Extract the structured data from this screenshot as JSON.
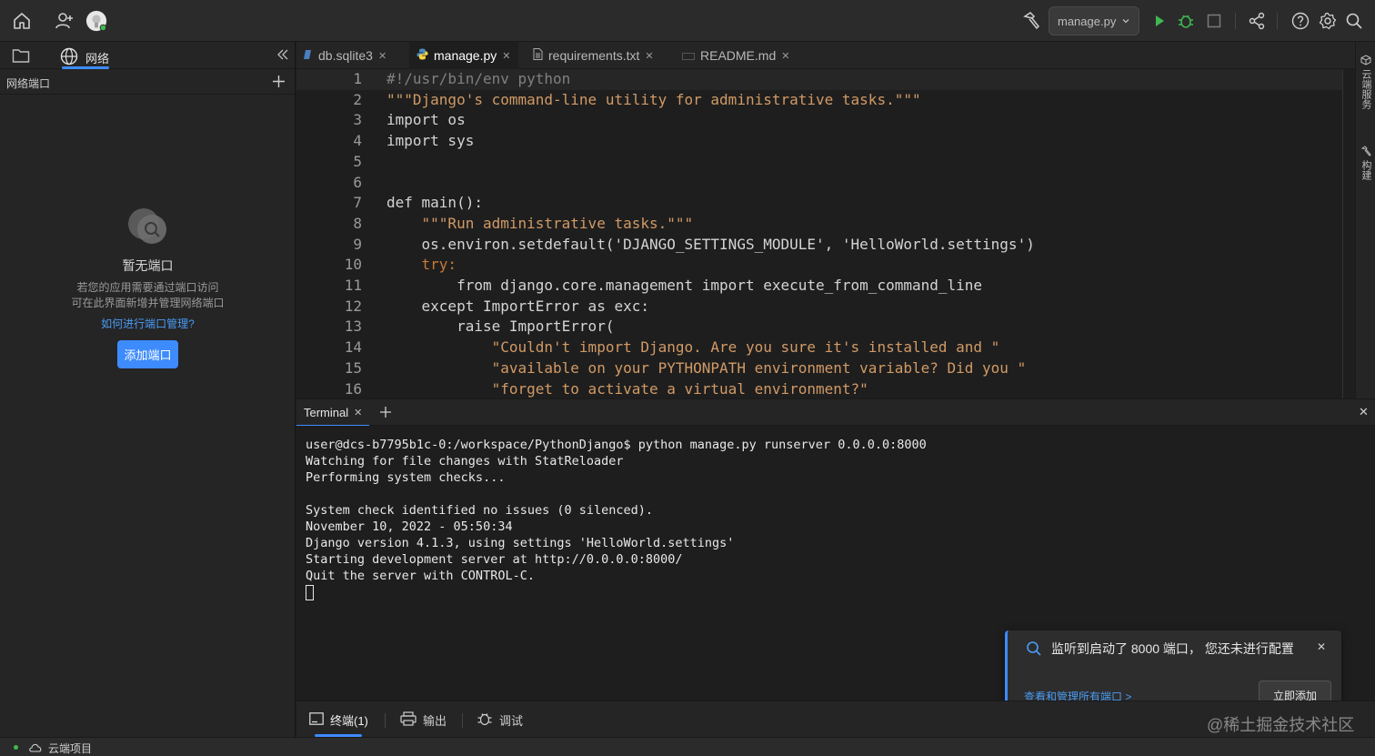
{
  "topbar": {
    "run_config": "manage.py"
  },
  "sidebar": {
    "tab_network_label": "网络",
    "header_title": "网络端口",
    "empty_title": "暂无端口",
    "empty_desc_1": "若您的应用需要通过端口访问",
    "empty_desc_2": "可在此界面新增并管理网络端口",
    "help_link": "如何进行端口管理?",
    "add_button": "添加端口"
  },
  "tabs": [
    {
      "label": "db.sqlite3"
    },
    {
      "label": "manage.py"
    },
    {
      "label": "requirements.txt"
    },
    {
      "label": "README.md"
    }
  ],
  "editor": {
    "lines": [
      {
        "n": "1",
        "t": "#!/usr/bin/env python"
      },
      {
        "n": "2",
        "t": "\"\"\"Django's command-line utility for administrative tasks.\"\"\""
      },
      {
        "n": "3",
        "t": "import os"
      },
      {
        "n": "4",
        "t": "import sys"
      },
      {
        "n": "5",
        "t": ""
      },
      {
        "n": "6",
        "t": ""
      },
      {
        "n": "7",
        "t": "def main():"
      },
      {
        "n": "8",
        "t": "    \"\"\"Run administrative tasks.\"\"\""
      },
      {
        "n": "9",
        "t": "    os.environ.setdefault('DJANGO_SETTINGS_MODULE', 'HelloWorld.settings')"
      },
      {
        "n": "10",
        "t": "    try:"
      },
      {
        "n": "11",
        "t": "        from django.core.management import execute_from_command_line"
      },
      {
        "n": "12",
        "t": "    except ImportError as exc:"
      },
      {
        "n": "13",
        "t": "        raise ImportError("
      },
      {
        "n": "14",
        "t": "            \"Couldn't import Django. Are you sure it's installed and \""
      },
      {
        "n": "15",
        "t": "            \"available on your PYTHONPATH environment variable? Did you \""
      },
      {
        "n": "16",
        "t": "            \"forget to activate a virtual environment?\""
      }
    ]
  },
  "right_rail": {
    "cloud_service": "云端服务",
    "build": "构建"
  },
  "terminal": {
    "tab_label": "Terminal",
    "lines": [
      "user@dcs-b7795b1c-0:/workspace/PythonDjango$ python manage.py runserver 0.0.0.0:8000",
      "Watching for file changes with StatReloader",
      "Performing system checks...",
      "",
      "System check identified no issues (0 silenced).",
      "November 10, 2022 - 05:50:34",
      "Django version 4.1.3, using settings 'HelloWorld.settings'",
      "Starting development server at http://0.0.0.0:8000/",
      "Quit the server with CONTROL-C."
    ]
  },
  "bottom_tabs": {
    "terminal": "终端(1)",
    "output": "输出",
    "debug": "调试"
  },
  "statusbar": {
    "project": "云端项目"
  },
  "toast": {
    "message": "监听到启动了 8000 端口，  您还未进行配置",
    "link": "查看和管理所有端口 >",
    "button": "立即添加"
  },
  "watermark": "@稀土掘金技术社区",
  "colors": {
    "accent": "#3d8bfd",
    "run_green": "#3fb950"
  }
}
